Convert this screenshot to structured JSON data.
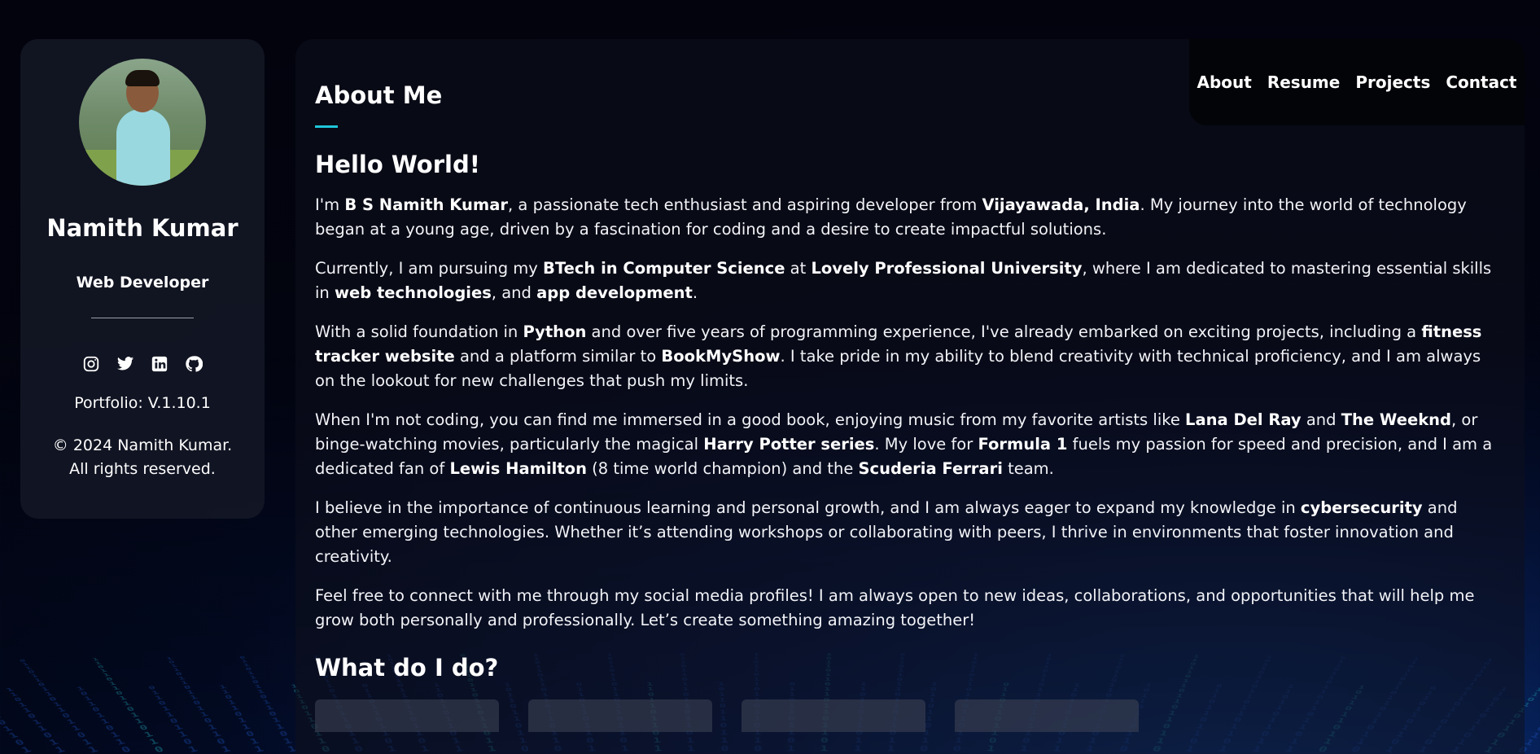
{
  "profile": {
    "name": "Namith Kumar",
    "role": "Web Developer",
    "version": "Portfolio: V.1.10.1",
    "copyright_line1": "© 2024 Namith Kumar.",
    "copyright_line2": "All rights reserved.",
    "socials": [
      "instagram-icon",
      "twitter-icon",
      "linkedin-icon",
      "github-icon"
    ]
  },
  "nav": {
    "items": [
      "About",
      "Resume",
      "Projects",
      "Contact"
    ]
  },
  "about": {
    "title": "About Me",
    "greeting": "Hello World!",
    "p1": {
      "a": "I'm ",
      "b1": "B S Namith Kumar",
      "c": ", a passionate tech enthusiast and aspiring developer from ",
      "b2": "Vijayawada, India",
      "d": ". My journey into the world of technology began at a young age, driven by a fascination for coding and a desire to create impactful solutions."
    },
    "p2": {
      "a": "Currently, I am pursuing my ",
      "b1": "BTech in Computer Science",
      "c": " at ",
      "b2": "Lovely Professional University",
      "d": ", where I am dedicated to mastering essential skills in ",
      "b3": "web technologies",
      "e": ", and ",
      "b4": "app development",
      "f": "."
    },
    "p3": {
      "a": "With a solid foundation in ",
      "b1": "Python",
      "c": " and over five years of programming experience, I've already embarked on exciting projects, including a ",
      "b2": "fitness tracker website",
      "d": " and a platform similar to ",
      "b3": "BookMyShow",
      "e": ". I take pride in my ability to blend creativity with technical proficiency, and I am always on the lookout for new challenges that push my limits."
    },
    "p4": {
      "a": "When I'm not coding, you can find me immersed in a good book, enjoying music from my favorite artists like ",
      "b1": "Lana Del Ray",
      "c": " and ",
      "b2": "The Weeknd",
      "d": ", or binge-watching movies, particularly the magical ",
      "b3": "Harry Potter series",
      "e": ". My love for ",
      "b4": "Formula 1",
      "f": " fuels my passion for speed and precision, and I am a dedicated fan of ",
      "b5": "Lewis Hamilton",
      "g": " (8 time world champion) and the ",
      "b6": "Scuderia Ferrari",
      "h": " team."
    },
    "p5": {
      "a": "I believe in the importance of continuous learning and personal growth, and I am always eager to expand my knowledge in ",
      "b1": "cybersecurity",
      "c": " and other emerging technologies. Whether it’s attending workshops or collaborating with peers, I thrive in environments that foster innovation and creativity."
    },
    "p6": {
      "a": "Feel free to connect with me through my social media profiles! I am always open to new ideas, collaborations, and opportunities that will help me grow both personally and professionally. Let’s create something amazing together!"
    },
    "what_title": "What do I do?"
  },
  "colors": {
    "accent": "#1ec6d9",
    "background": "#02030d",
    "panel": "#161a28"
  }
}
